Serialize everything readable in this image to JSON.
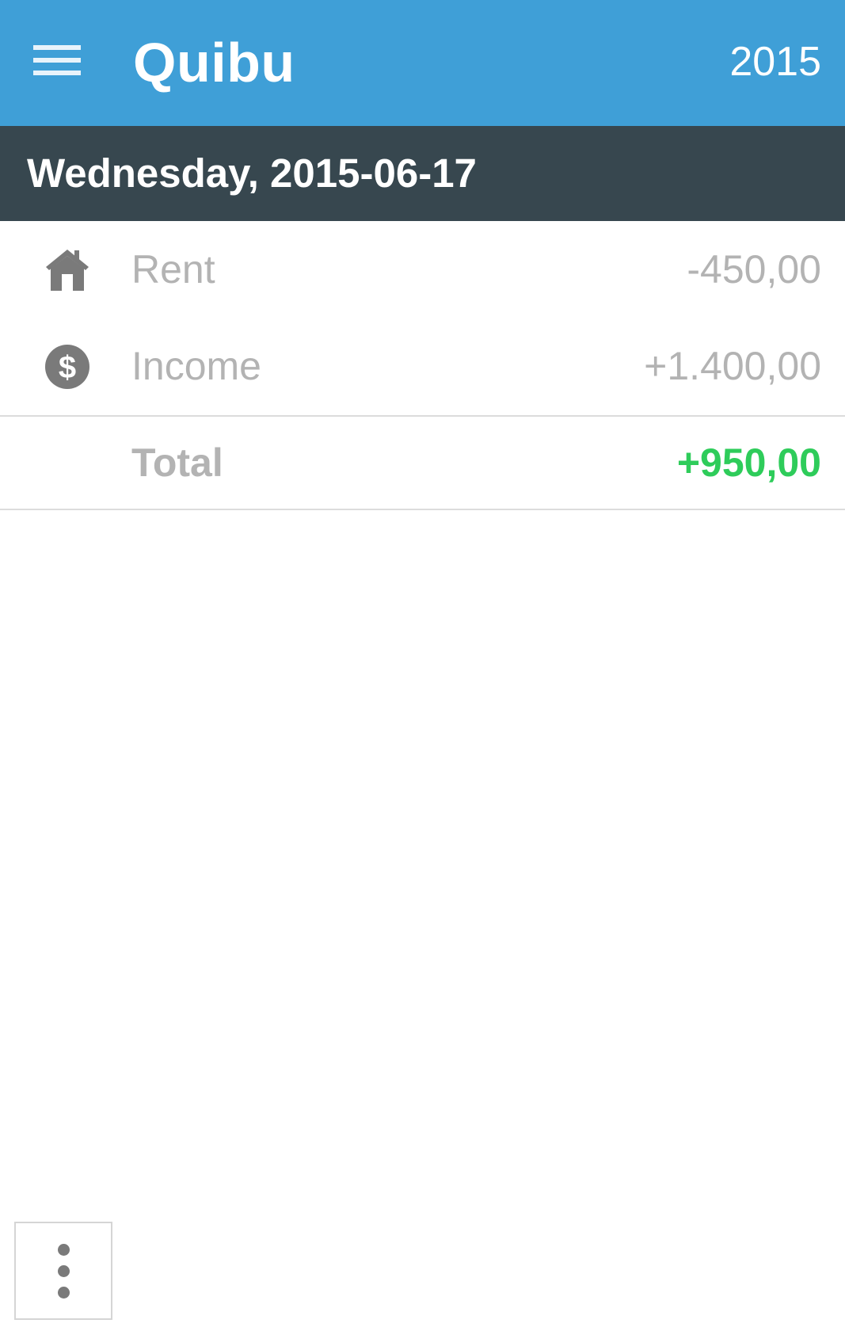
{
  "app_bar": {
    "title": "Quibu",
    "year": "2015",
    "menu_icon": "hamburger-menu-icon",
    "background": "#3f9fd7"
  },
  "date_header": {
    "text": "Wednesday, 2015-06-17",
    "background": "#37474f"
  },
  "entries": [
    {
      "icon": "house-icon",
      "label": "Rent",
      "amount": "-450,00"
    },
    {
      "icon": "dollar-icon",
      "label": "Income",
      "amount": "+1.400,00"
    }
  ],
  "total": {
    "label": "Total",
    "amount": "+950,00",
    "color": "#2ecc5a"
  },
  "overflow_menu": {
    "icon": "more-vertical-icon"
  }
}
